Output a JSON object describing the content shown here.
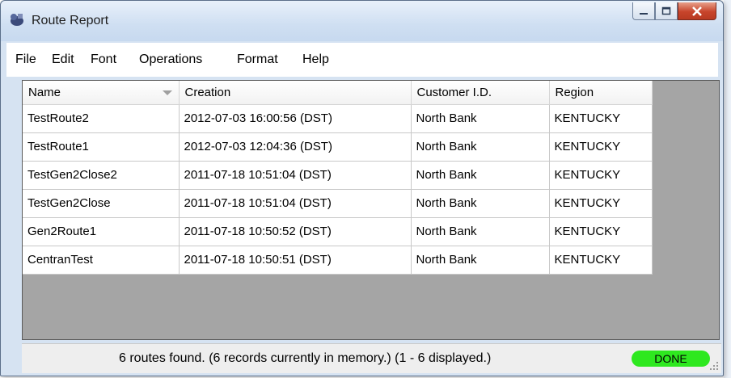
{
  "window": {
    "title": "Route Report",
    "controls": {
      "minimize": "minimize",
      "maximize": "maximize",
      "close": "close"
    }
  },
  "menubar": {
    "items": [
      "File",
      "Edit",
      "Font",
      "Operations",
      "Format",
      "Help"
    ]
  },
  "grid": {
    "columns": [
      "Name",
      "Creation",
      "Customer I.D.",
      "Region"
    ],
    "sort_column": "Name",
    "rows": [
      [
        "TestRoute2",
        "2012-07-03 16:00:56 (DST)",
        "North Bank",
        "KENTUCKY"
      ],
      [
        "TestRoute1",
        "2012-07-03 12:04:36 (DST)",
        "North Bank",
        "KENTUCKY"
      ],
      [
        "TestGen2Close2",
        "2011-07-18 10:51:04 (DST)",
        "North Bank",
        "KENTUCKY"
      ],
      [
        "TestGen2Close",
        "2011-07-18 10:51:04 (DST)",
        "North Bank",
        "KENTUCKY"
      ],
      [
        "Gen2Route1",
        "2011-07-18 10:50:52 (DST)",
        "North Bank",
        "KENTUCKY"
      ],
      [
        "CentranTest",
        "2011-07-18 10:50:51 (DST)",
        "North Bank",
        "KENTUCKY"
      ]
    ]
  },
  "statusbar": {
    "message": "6 routes found.  (6 records currently in memory.)  (1 - 6 displayed.)",
    "badge": "DONE",
    "badge_color": "#2ee81f"
  },
  "colors": {
    "grid_background": "#a5a5a5",
    "titlebar": "#cfdff2",
    "close_button": "#c7442b"
  }
}
